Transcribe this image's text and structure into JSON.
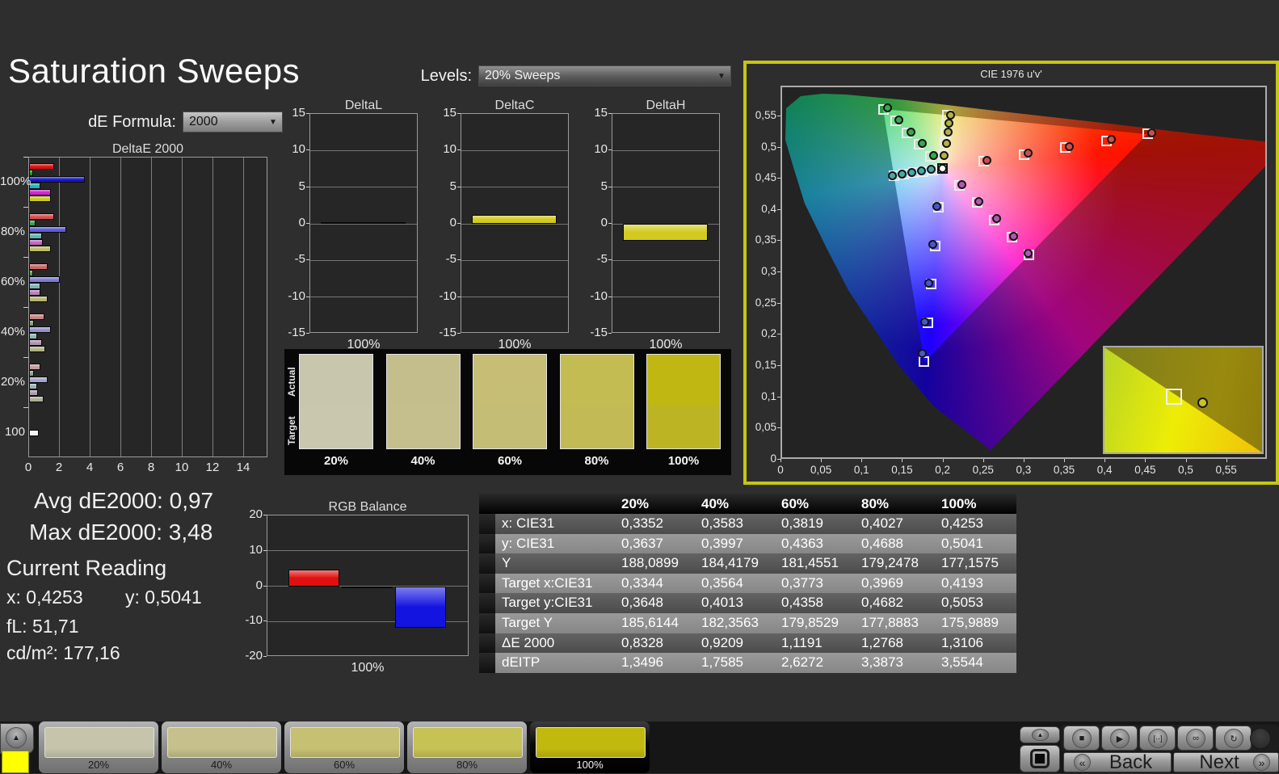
{
  "page": {
    "title": "Saturation Sweeps"
  },
  "controls": {
    "de_formula_label": "dE Formula:",
    "de_formula_value": "2000",
    "levels_label": "Levels:",
    "levels_value": "20% Sweeps"
  },
  "stats": {
    "avg": "Avg dE2000: 0,97",
    "max": "Max dE2000: 3,48",
    "current_reading": "Current Reading",
    "x": "x: 0,4253",
    "y": "y: 0,5041",
    "fl": "fL: 51,71",
    "cdm2": "cd/m²: 177,16"
  },
  "chart_data": [
    {
      "id": "deltaE2000",
      "type": "bar",
      "orientation": "horizontal",
      "title": "DeltaE 2000",
      "xlim": [
        0,
        15.6
      ],
      "xticks": [
        0,
        2,
        4,
        6,
        8,
        10,
        12,
        14
      ],
      "groups": [
        {
          "label": "100%",
          "values": [
            1.5,
            0.15,
            3.5,
            0.65,
            1.3,
            1.3
          ],
          "colors": [
            "#dd1111",
            "#11a011",
            "#1616c8",
            "#22b2ba",
            "#d022d0",
            "#c9c91a"
          ],
          "series": [
            "red",
            "green",
            "blue",
            "cyan",
            "magenta",
            "yellow"
          ]
        },
        {
          "label": "80%",
          "values": [
            1.5,
            0.3,
            2.3,
            0.75,
            0.8,
            1.3
          ],
          "colors": [
            "#d84f4f",
            "#3aa04a",
            "#5b5bd8",
            "#62b2b2",
            "#c066c0",
            "#bcbc5c"
          ]
        },
        {
          "label": "60%",
          "values": [
            1.1,
            0.12,
            1.9,
            0.65,
            0.65,
            1.1
          ],
          "colors": [
            "#cc6666",
            "#55a055",
            "#7b7bd2",
            "#7cb4b4",
            "#ba7cba",
            "#b4b46e"
          ]
        },
        {
          "label": "40%",
          "values": [
            0.9,
            0.2,
            1.3,
            0.4,
            0.75,
            0.95
          ],
          "colors": [
            "#c88383",
            "#74a474",
            "#9292cc",
            "#92b4b4",
            "#b292b2",
            "#b2b284"
          ]
        },
        {
          "label": "20%",
          "values": [
            0.65,
            0.2,
            1.1,
            0.4,
            0.45,
            0.85
          ],
          "colors": [
            "#c29c9c",
            "#8aa48a",
            "#a4a4ca",
            "#9cb0b0",
            "#ac9cac",
            "#acac94"
          ]
        },
        {
          "label": "100",
          "values": [
            0.55
          ],
          "colors": [
            "#f2f2f2"
          ]
        }
      ]
    },
    {
      "id": "deltaL",
      "type": "bar",
      "title": "DeltaL",
      "ylim": [
        -15,
        15
      ],
      "yticks": [
        15,
        10,
        5,
        0,
        -5,
        -10,
        -15
      ],
      "categories": [
        "100%"
      ],
      "values": [
        0.2
      ],
      "bar_color": "#0a0a0a"
    },
    {
      "id": "deltaC",
      "type": "bar",
      "title": "DeltaC",
      "ylim": [
        -15,
        15
      ],
      "yticks": [
        15,
        10,
        5,
        0,
        -5,
        -10,
        -15
      ],
      "categories": [
        "100%"
      ],
      "values": [
        1.2
      ],
      "bar_color": "#d2ca1e"
    },
    {
      "id": "deltaH",
      "type": "bar",
      "title": "DeltaH",
      "ylim": [
        -15,
        15
      ],
      "yticks": [
        15,
        10,
        5,
        0,
        -5,
        -10,
        -15
      ],
      "categories": [
        "100%"
      ],
      "values": [
        -2.3
      ],
      "bar_color": "#d2ca1e"
    },
    {
      "id": "rgb_balance",
      "type": "bar",
      "title": "RGB Balance",
      "ylim": [
        -20,
        20
      ],
      "yticks": [
        20,
        10,
        0,
        -10,
        -20
      ],
      "categories": [
        "100%"
      ],
      "series": [
        {
          "name": "red",
          "value": 4.8,
          "color": "#e01010"
        },
        {
          "name": "green",
          "value": -0.5,
          "color": "#2f9e2f"
        },
        {
          "name": "blue",
          "value": -11.8,
          "color": "#1414e0"
        }
      ]
    },
    {
      "id": "cie_diagram",
      "type": "scatter",
      "title": "CIE 1976 u'v'",
      "xlim": [
        0,
        0.6
      ],
      "ylim": [
        0,
        0.5977
      ],
      "xtick_labels": [
        "0",
        "0,05",
        "0,1",
        "0,15",
        "0,2",
        "0,25",
        "0,3",
        "0,35",
        "0,4",
        "0,45",
        "0,5",
        "0,55"
      ],
      "ytick_labels": [
        "0,55",
        "0,5",
        "0,45",
        "0,4",
        "0,35",
        "0,3",
        "0,25",
        "0,2",
        "0,15",
        "0,1",
        "0,05",
        "0"
      ],
      "white_point": {
        "u": 0.1978,
        "v": 0.4683
      },
      "sweeps": [
        {
          "name": "red",
          "color": "#c85050",
          "targets": [
            [
              0.2484,
              0.4792
            ],
            [
              0.299,
              0.4901
            ],
            [
              0.3495,
              0.5011
            ],
            [
              0.4001,
              0.512
            ],
            [
              0.4507,
              0.5229
            ]
          ],
          "measured": [
            [
              0.2525,
              0.481
            ],
            [
              0.3035,
              0.492
            ],
            [
              0.354,
              0.503
            ],
            [
              0.406,
              0.514
            ],
            [
              0.456,
              0.525
            ]
          ]
        },
        {
          "name": "green",
          "color": "#3aa84a",
          "targets": [
            [
              0.1832,
              0.4871
            ],
            [
              0.1687,
              0.506
            ],
            [
              0.1541,
              0.5248
            ],
            [
              0.1396,
              0.5437
            ],
            [
              0.125,
              0.5625
            ]
          ],
          "measured": [
            [
              0.187,
              0.488
            ],
            [
              0.173,
              0.5075
            ],
            [
              0.159,
              0.5265
            ],
            [
              0.1445,
              0.5455
            ],
            [
              0.13,
              0.5645
            ]
          ]
        },
        {
          "name": "blue",
          "color": "#4858c8",
          "targets": [
            [
              0.1933,
              0.4062
            ],
            [
              0.1888,
              0.3441
            ],
            [
              0.1843,
              0.2821
            ],
            [
              0.1799,
              0.22
            ],
            [
              0.1754,
              0.1579
            ]
          ],
          "measured": [
            [
              0.1905,
              0.4075
            ],
            [
              0.1855,
              0.346
            ],
            [
              0.181,
              0.284
            ],
            [
              0.1763,
              0.2225
            ],
            [
              0.1725,
              0.172
            ]
          ]
        },
        {
          "name": "cyan",
          "color": "#48a8a8",
          "targets": [
            [
              0.1859,
              0.4657
            ],
            [
              0.174,
              0.4631
            ],
            [
              0.1621,
              0.4606
            ],
            [
              0.1502,
              0.458
            ],
            [
              0.1383,
              0.4554
            ]
          ],
          "measured": [
            [
              0.184,
              0.4665
            ],
            [
              0.1718,
              0.464
            ],
            [
              0.1598,
              0.4615
            ],
            [
              0.1478,
              0.459
            ],
            [
              0.1358,
              0.456
            ]
          ]
        },
        {
          "name": "magenta",
          "color": "#b058b0",
          "targets": [
            [
              0.2192,
              0.4406
            ],
            [
              0.2407,
              0.4129
            ],
            [
              0.2621,
              0.3852
            ],
            [
              0.2836,
              0.3575
            ],
            [
              0.305,
              0.3298
            ]
          ],
          "measured": [
            [
              0.2215,
              0.442
            ],
            [
              0.243,
              0.4145
            ],
            [
              0.2645,
              0.387
            ],
            [
              0.2858,
              0.359
            ],
            [
              0.3035,
              0.332
            ]
          ]
        },
        {
          "name": "yellow",
          "color": "#b8b048",
          "targets": [
            [
              0.1994,
              0.4894
            ],
            [
              0.2007,
              0.5085
            ],
            [
              0.2019,
              0.5247
            ],
            [
              0.2029,
              0.5386
            ],
            [
              0.2039,
              0.5529
            ]
          ],
          "measured": [
            [
              0.2003,
              0.489
            ],
            [
              0.2024,
              0.5081
            ],
            [
              0.2045,
              0.5255
            ],
            [
              0.206,
              0.5395
            ],
            [
              0.2075,
              0.5534
            ]
          ]
        }
      ],
      "inset": {
        "square": [
          0.44,
          0.47
        ],
        "circle": [
          0.62,
          0.52
        ]
      }
    }
  ],
  "table": {
    "columns": [
      "20%",
      "40%",
      "60%",
      "80%",
      "100%"
    ],
    "rows": [
      {
        "label": "x: CIE31",
        "values": [
          "0,3352",
          "0,3583",
          "0,3819",
          "0,4027",
          "0,4253"
        ]
      },
      {
        "label": "y: CIE31",
        "values": [
          "0,3637",
          "0,3997",
          "0,4363",
          "0,4688",
          "0,5041"
        ]
      },
      {
        "label": "Y",
        "values": [
          "188,0899",
          "184,4179",
          "181,4551",
          "179,2478",
          "177,1575"
        ]
      },
      {
        "label": "Target x:CIE31",
        "values": [
          "0,3344",
          "0,3564",
          "0,3773",
          "0,3969",
          "0,4193"
        ]
      },
      {
        "label": "Target y:CIE31",
        "values": [
          "0,3648",
          "0,4013",
          "0,4358",
          "0,4682",
          "0,5053"
        ]
      },
      {
        "label": "Target Y",
        "values": [
          "185,6144",
          "182,3563",
          "179,8529",
          "177,8883",
          "175,9889"
        ]
      },
      {
        "label": "ΔE 2000",
        "values": [
          "0,8328",
          "0,9209",
          "1,1191",
          "1,2768",
          "1,3106"
        ]
      },
      {
        "label": "dEITP",
        "values": [
          "1,3496",
          "1,7585",
          "2,6272",
          "3,3873",
          "3,5544"
        ]
      }
    ]
  },
  "swatch_panel": {
    "row_labels": [
      "Actual",
      "Target"
    ],
    "columns": [
      "20%",
      "40%",
      "60%",
      "80%",
      "100%"
    ],
    "actual_colors": [
      "#c8c7ae",
      "#c4be8c",
      "#c5be74",
      "#c3bc52",
      "#c0b713"
    ],
    "target_colors": [
      "#c9c8af",
      "#c5bf8e",
      "#c4bd75",
      "#c2bb55",
      "#bcb423"
    ]
  },
  "bottom_bar": {
    "corner_color": "#ffff00",
    "tiles": [
      {
        "label": "20%",
        "color": "#c6c5ab",
        "selected": false
      },
      {
        "label": "40%",
        "color": "#c5c08c",
        "selected": false
      },
      {
        "label": "60%",
        "color": "#c6c072",
        "selected": false
      },
      {
        "label": "80%",
        "color": "#c7c254",
        "selected": false
      },
      {
        "label": "100%",
        "color": "#c2b90e",
        "selected": true
      }
    ]
  },
  "nav": {
    "back_label": "Back",
    "next_label": "Next",
    "back_glyph": "«",
    "next_glyph": "»",
    "up_glyph": "▲",
    "stop_square_glyph": "■",
    "transport": [
      {
        "name": "stop-icon",
        "glyph": "■"
      },
      {
        "name": "play-icon",
        "glyph": "▶"
      },
      {
        "name": "range-icon",
        "glyph": "[··]"
      },
      {
        "name": "loop-icon",
        "glyph": "∞"
      },
      {
        "name": "refresh-icon",
        "glyph": "↻"
      }
    ]
  }
}
